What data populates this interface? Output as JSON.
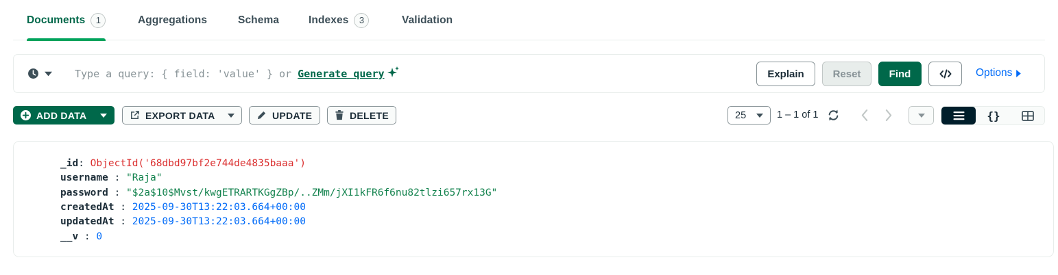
{
  "tabs": [
    {
      "label": "Documents",
      "count": "1",
      "active": true
    },
    {
      "label": "Aggregations"
    },
    {
      "label": "Schema"
    },
    {
      "label": "Indexes",
      "count": "3"
    },
    {
      "label": "Validation"
    }
  ],
  "query": {
    "placeholder": "Type a query: { field: 'value' } or",
    "generate_label": "Generate query",
    "explain_label": "Explain",
    "reset_label": "Reset",
    "find_label": "Find",
    "options_label": "Options"
  },
  "toolbar": {
    "add_data_label": "ADD DATA",
    "export_data_label": "EXPORT DATA",
    "update_label": "UPDATE",
    "delete_label": "DELETE",
    "page_size": "25",
    "range_text": "1 – 1 of 1"
  },
  "document": {
    "fields": [
      {
        "key": "_id",
        "sep": ": ",
        "value": "ObjectId('68dbd97bf2e744de4835baaa')",
        "type": "oid"
      },
      {
        "key": "username",
        "sep": " : ",
        "value": "\"Raja\"",
        "type": "str"
      },
      {
        "key": "password",
        "sep": " : ",
        "value": "\"$2a$10$Mvst/kwgETRARTKGgZBp/..ZMm/jXI1kFR6f6nu82tlzi657rx13G\"",
        "type": "str"
      },
      {
        "key": "createdAt",
        "sep": " : ",
        "value": "2025-09-30T13:22:03.664+00:00",
        "type": "date"
      },
      {
        "key": "updatedAt",
        "sep": " : ",
        "value": "2025-09-30T13:22:03.664+00:00",
        "type": "date"
      },
      {
        "key": "__v",
        "sep": " : ",
        "value": "0",
        "type": "num"
      }
    ]
  },
  "colors": {
    "brand_green": "#00684a",
    "accent_green": "#00a35c",
    "link_blue": "#016bf8",
    "objectid_red": "#db3030"
  }
}
